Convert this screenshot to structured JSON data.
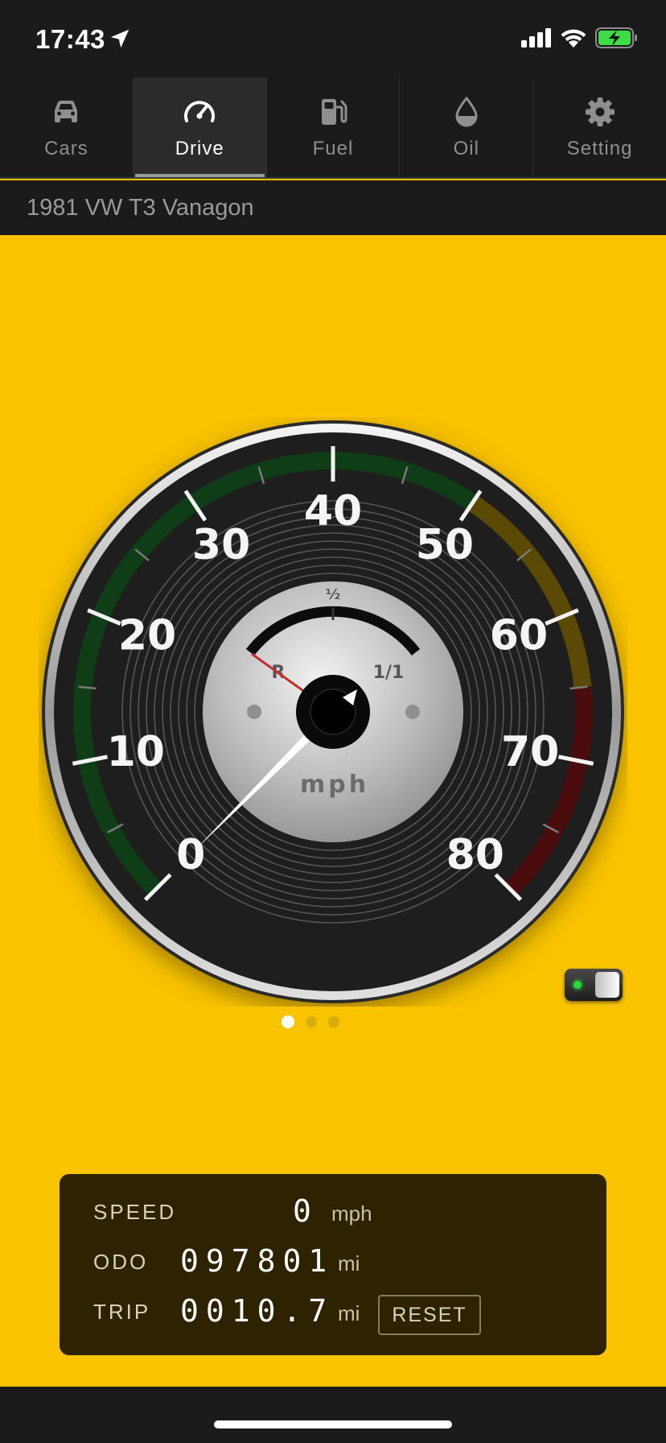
{
  "status": {
    "time": "17:43"
  },
  "tabs": [
    {
      "label": "Cars",
      "icon": "car-icon"
    },
    {
      "label": "Drive",
      "icon": "speedometer-icon",
      "active": true
    },
    {
      "label": "Fuel",
      "icon": "fuel-pump-icon"
    },
    {
      "label": "Oil",
      "icon": "oil-drop-icon"
    },
    {
      "label": "Setting",
      "icon": "gear-icon"
    }
  ],
  "car": {
    "name": "1981 VW T3 Vanagon"
  },
  "gauge": {
    "unit": "mph",
    "scale_min": 0,
    "scale_max": 80,
    "ticks": [
      "0",
      "10",
      "20",
      "30",
      "40",
      "50",
      "60",
      "70",
      "80"
    ],
    "current_speed": 0,
    "sub_dial": {
      "top_label": "½",
      "left_label": "R",
      "right_label": "1/1"
    },
    "zone_colors": {
      "green": "#0f3d16",
      "yellow": "#5a4a06",
      "red": "#4a0c0c"
    }
  },
  "pager": {
    "pages": 3,
    "active": 0
  },
  "readout": {
    "speed_label": "SPEED",
    "speed_value": "0",
    "speed_unit": "mph",
    "odo_label": "ODO",
    "odo_value": "097801",
    "odo_unit": "mi",
    "trip_label": "TRIP",
    "trip_value": "0010.7",
    "trip_unit": "mi",
    "reset_label": "RESET"
  },
  "colors": {
    "background": "#f9c300",
    "panel": "#2e2300",
    "bar": "#1b1b1b"
  }
}
